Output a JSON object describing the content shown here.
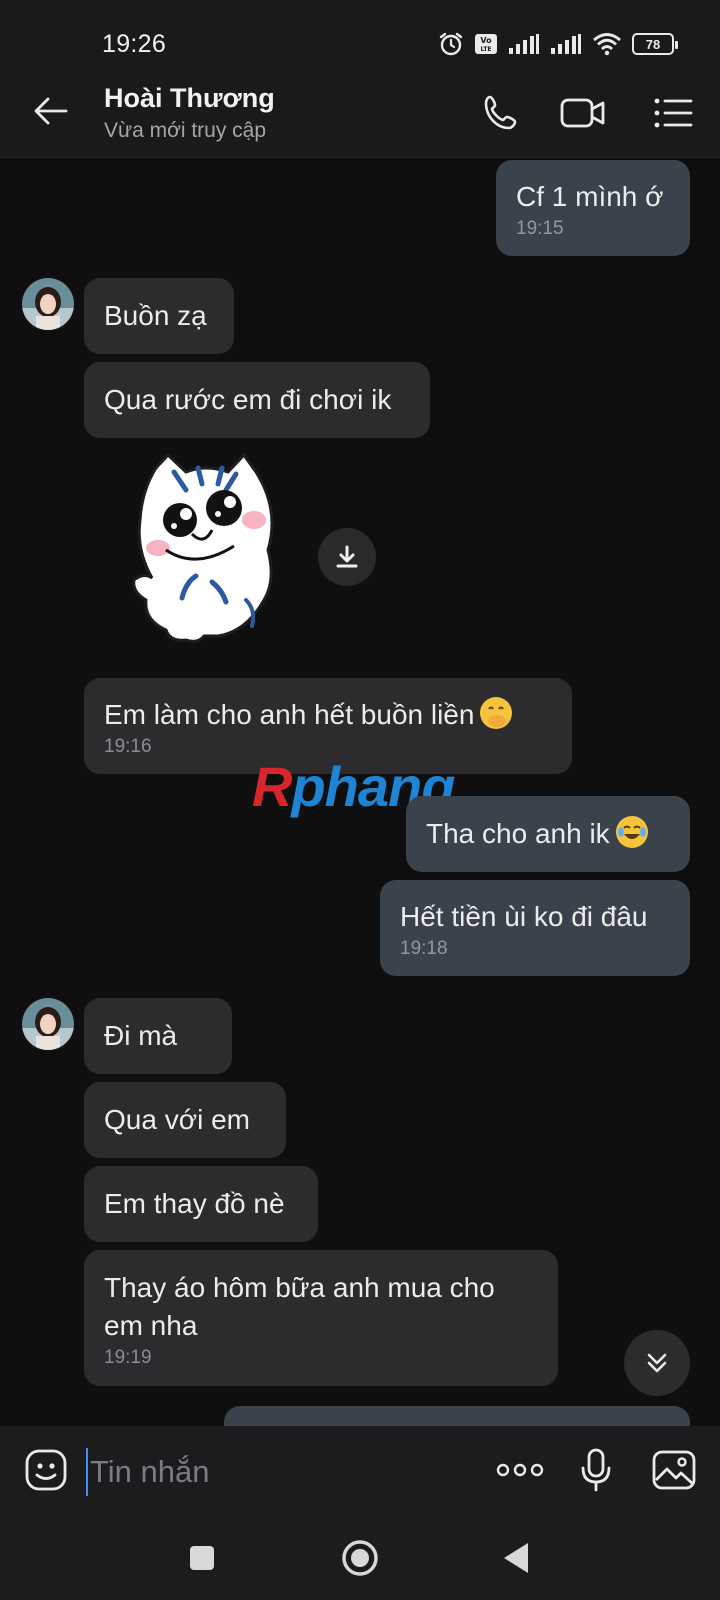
{
  "status_bar": {
    "time": "19:26",
    "battery": "78",
    "icons": [
      "alarm-icon",
      "volte-icon",
      "signal-icon",
      "signal-icon",
      "wifi-icon",
      "battery-icon"
    ]
  },
  "header": {
    "contact_name": "Hoài Thương",
    "contact_status": "Vừa mới truy cập",
    "icons": [
      "back-arrow-icon",
      "phone-icon",
      "video-call-icon",
      "menu-list-icon"
    ]
  },
  "messages": [
    {
      "from": "me",
      "text": "Cf 1 mình ớ",
      "time": "19:15"
    },
    {
      "from": "them",
      "text": "Buồn zạ"
    },
    {
      "from": "them",
      "text": "Qua rước em đi chơi ik"
    },
    {
      "from": "them",
      "type": "sticker",
      "sticker": "cat-sticker"
    },
    {
      "from": "them",
      "text": "Em làm cho anh hết buồn liền",
      "emoji": "face-with-hand-over-mouth",
      "time": "19:16"
    },
    {
      "from": "me",
      "text": "Tha cho anh ik",
      "emoji": "face-with-tears-of-joy"
    },
    {
      "from": "me",
      "text": "Hết tiền ùi ko đi đâu",
      "time": "19:18"
    },
    {
      "from": "them",
      "text": "Đi mà"
    },
    {
      "from": "them",
      "text": "Qua với em"
    },
    {
      "from": "them",
      "text": "Em thay đồ nè"
    },
    {
      "from": "them",
      "text": "Thay áo hôm bữa anh mua cho\nem nha",
      "time": "19:19"
    }
  ],
  "watermark": {
    "part1": "R",
    "part2": "phang"
  },
  "input_bar": {
    "placeholder": "Tin nhắn",
    "icons": [
      "emoji-icon",
      "more-icon",
      "microphone-icon",
      "image-icon"
    ]
  },
  "colors": {
    "background": "#0f0f10",
    "incoming_bubble": "#2c2c2e",
    "outgoing_bubble": "#3a424c",
    "accent": "#3e8ef7"
  }
}
